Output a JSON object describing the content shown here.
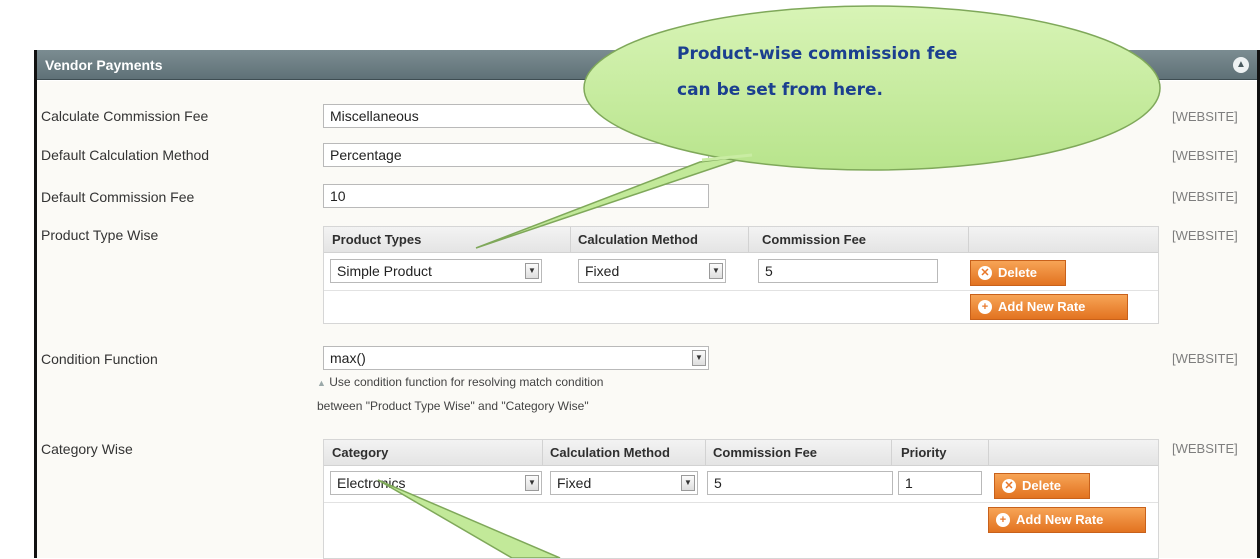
{
  "panel": {
    "title": "Vendor Payments",
    "collapse_icon": "chevron-up-icon",
    "colors": {
      "header": "#6b7c81",
      "button": "#eb8a36",
      "callout": "#c8eda0",
      "callout_text": "#1b3f8f"
    }
  },
  "fields": {
    "calculate_commission_fee": {
      "label": "Calculate Commission Fee",
      "value": "Miscellaneous",
      "scope": "[WEBSITE]"
    },
    "default_calculation_method": {
      "label": "Default Calculation Method",
      "value": "Percentage",
      "scope": "[WEBSITE]"
    },
    "default_commission_fee": {
      "label": "Default Commission Fee",
      "value": "10",
      "scope": "[WEBSITE]"
    },
    "product_type_wise": {
      "label": "Product Type Wise",
      "scope": "[WEBSITE]",
      "columns": [
        "Product Types",
        "Calculation Method",
        "Commission Fee"
      ],
      "row": {
        "product_type": "Simple Product",
        "calculation_method": "Fixed",
        "commission_fee": "5"
      },
      "delete_label": "Delete",
      "add_label": "Add New Rate"
    },
    "condition_function": {
      "label": "Condition Function",
      "value": "max()",
      "scope": "[WEBSITE]",
      "note_line1": "Use condition function for resolving match condition",
      "note_line2": "between \"Product Type Wise\" and \"Category Wise\""
    },
    "category_wise": {
      "label": "Category Wise",
      "scope": "[WEBSITE]",
      "columns": [
        "Category",
        "Calculation Method",
        "Commission Fee",
        "Priority"
      ],
      "row": {
        "category": "Electronics",
        "calculation_method": "Fixed",
        "commission_fee": "5",
        "priority": "1"
      },
      "delete_label": "Delete",
      "add_label": "Add New Rate"
    }
  },
  "callout": {
    "line1": "Product-wise  commission  fee",
    "line2": "can be set from here."
  }
}
